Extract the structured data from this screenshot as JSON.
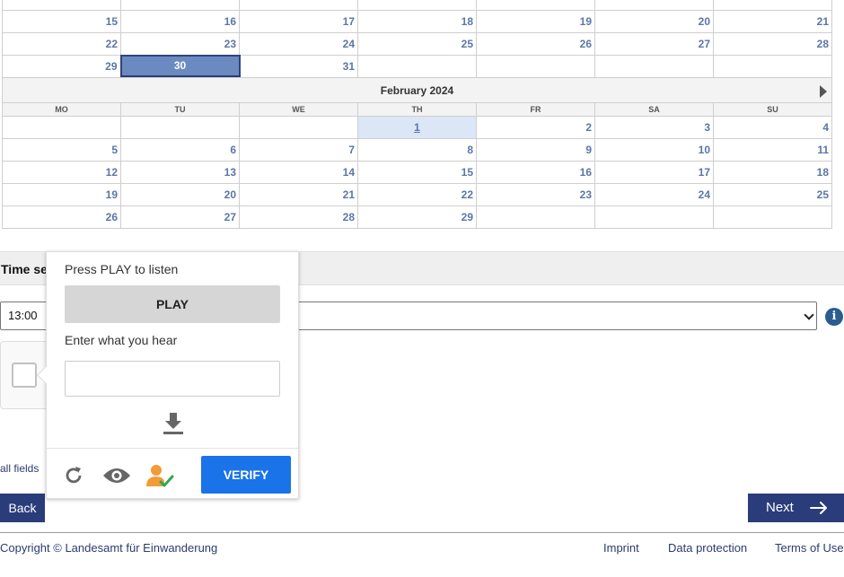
{
  "calendar_top": {
    "partial_row": [
      "",
      "",
      "",
      "",
      "",
      "",
      ""
    ],
    "rows": [
      [
        "15",
        "16",
        "17",
        "18",
        "19",
        "20",
        "21"
      ],
      [
        "22",
        "23",
        "24",
        "25",
        "26",
        "27",
        "28"
      ],
      [
        "29",
        "30",
        "31",
        "",
        "",
        "",
        ""
      ]
    ],
    "selected": "30"
  },
  "calendar_feb": {
    "month_title": "February 2024",
    "weekdays": [
      "MO",
      "TU",
      "WE",
      "TH",
      "FR",
      "SA",
      "SU"
    ],
    "rows": [
      [
        "",
        "",
        "",
        "1",
        "2",
        "3",
        "4"
      ],
      [
        "5",
        "6",
        "7",
        "8",
        "9",
        "10",
        "11"
      ],
      [
        "12",
        "13",
        "14",
        "15",
        "16",
        "17",
        "18"
      ],
      [
        "19",
        "20",
        "21",
        "22",
        "23",
        "24",
        "25"
      ],
      [
        "26",
        "27",
        "28",
        "29",
        "",
        "",
        ""
      ]
    ],
    "today": "1"
  },
  "time_section": {
    "title": "Time se",
    "selected_time": "13:00"
  },
  "required_note": "all fields",
  "buttons": {
    "back": "Back",
    "next": "Next"
  },
  "captcha_popup": {
    "instruction": "Press PLAY to listen",
    "play_label": "PLAY",
    "input_label": "Enter what you hear",
    "input_value": "",
    "verify_label": "VERIFY"
  },
  "footer": {
    "copyright": "Copyright © Landesamt für Einwanderung",
    "links": [
      "Imprint",
      "Data protection",
      "Terms of Use"
    ]
  },
  "colors": {
    "date_text": "#5b76a8",
    "selected_bg": "#6b8ac2",
    "today_bg": "#dbe6f7",
    "primary_button": "#2a3c7a",
    "verify_button": "#1a73e8"
  }
}
